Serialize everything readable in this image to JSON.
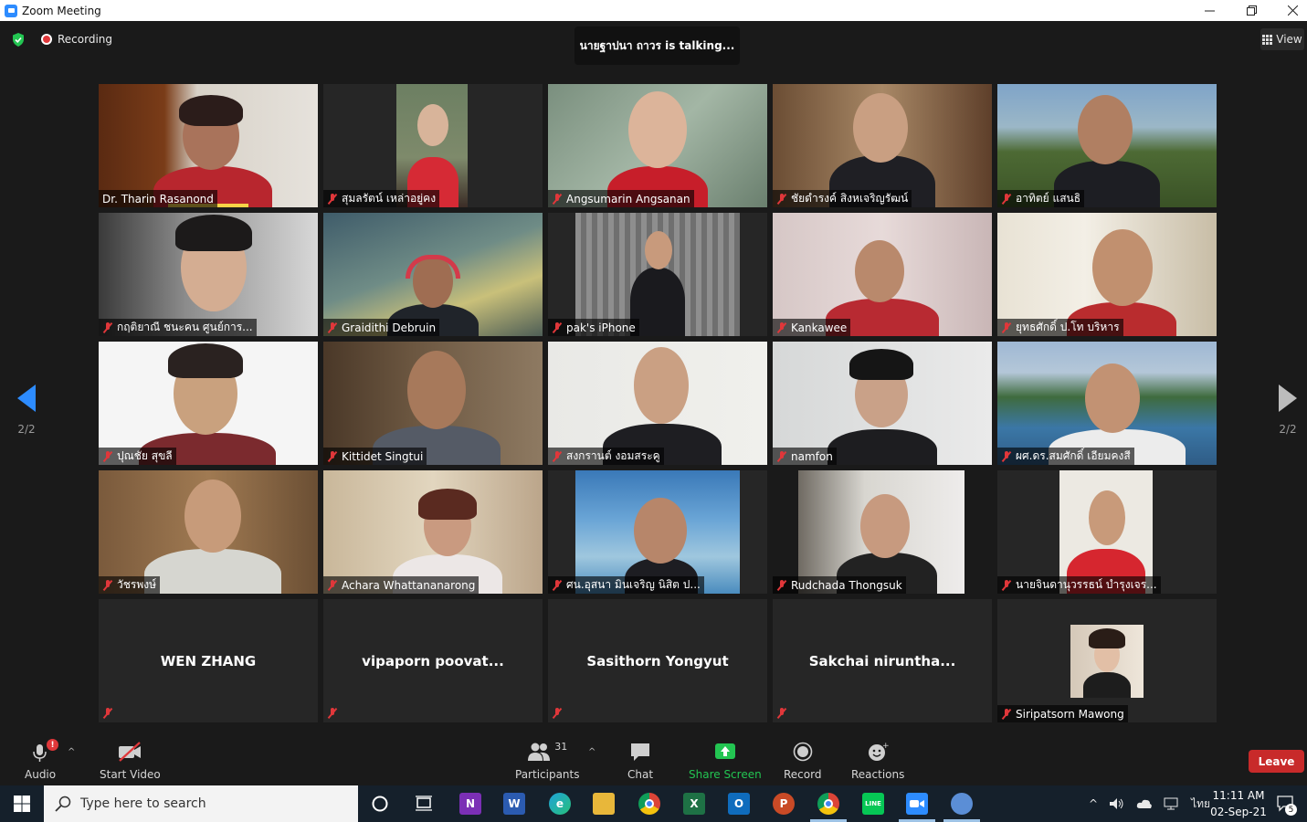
{
  "window": {
    "title": "Zoom Meeting"
  },
  "meeting": {
    "recording_label": "Recording",
    "talking_text": "นายฐาปนา ถาวร is  talking...",
    "view_label": "View",
    "page_left": "2/2",
    "page_right": "2/2"
  },
  "participants": [
    {
      "name": "Dr. Tharin Rasanond",
      "muted": false
    },
    {
      "name": "สุมลรัตน์ เหล่าอยู่คง",
      "muted": true
    },
    {
      "name": "Angsumarin Angsanan",
      "muted": true
    },
    {
      "name": "ชัยดำรงค์  สิงหเจริญรัฒน์",
      "muted": true
    },
    {
      "name": "อาทิตย์ แสนธิ",
      "muted": true
    },
    {
      "name": "กฤติยาณี ชนะคน ศูนย์การ...",
      "muted": true
    },
    {
      "name": "Graidithi Debruin",
      "muted": true
    },
    {
      "name": "pak's iPhone",
      "muted": true
    },
    {
      "name": "Kankawee",
      "muted": true
    },
    {
      "name": "ยุทธศักดิ์ ป.โท บริหาร",
      "muted": true
    },
    {
      "name": "ปุณชัย สุขลี",
      "muted": true
    },
    {
      "name": "Kittidet Singtui",
      "muted": true
    },
    {
      "name": "สงกรานต์ งอมสระคู",
      "muted": true
    },
    {
      "name": "namfon",
      "muted": true
    },
    {
      "name": "ผศ.ดร.สมศักดิ์ เอียมคงสี",
      "muted": true
    },
    {
      "name": "วัชรพงษ์",
      "muted": true
    },
    {
      "name": "Achara Whattananarong",
      "muted": true
    },
    {
      "name": "ศน.อุสนา มินเจริญ นิสิต ป...",
      "muted": true
    },
    {
      "name": "Rudchada Thongsuk",
      "muted": true
    },
    {
      "name": "นายจินดานุวรรธน์ บำรุงเจร...",
      "muted": true
    },
    {
      "name": "WEN ZHANG",
      "muted": true
    },
    {
      "name": "vipaporn  poovat...",
      "muted": true
    },
    {
      "name": "Sasithorn Yongyut",
      "muted": true
    },
    {
      "name": "Sakchai  nirunthа...",
      "muted": true
    },
    {
      "name": "Siripatsorn Mawong",
      "muted": true
    }
  ],
  "toolbar": {
    "audio_label": "Audio",
    "video_label": "Start Video",
    "participants_label": "Participants",
    "participants_count": "31",
    "chat_label": "Chat",
    "share_label": "Share Screen",
    "record_label": "Record",
    "reactions_label": "Reactions",
    "leave_label": "Leave"
  },
  "taskbar": {
    "search_placeholder": "Type here to search",
    "lang": "ไทย",
    "time": "11:11 AM",
    "date": "02-Sep-21",
    "notifications": "5"
  },
  "colors": {
    "zoom_blue": "#2d8cff",
    "leave_red": "#c82a2a",
    "share_green": "#23c552",
    "mute_red": "#e0373a"
  }
}
